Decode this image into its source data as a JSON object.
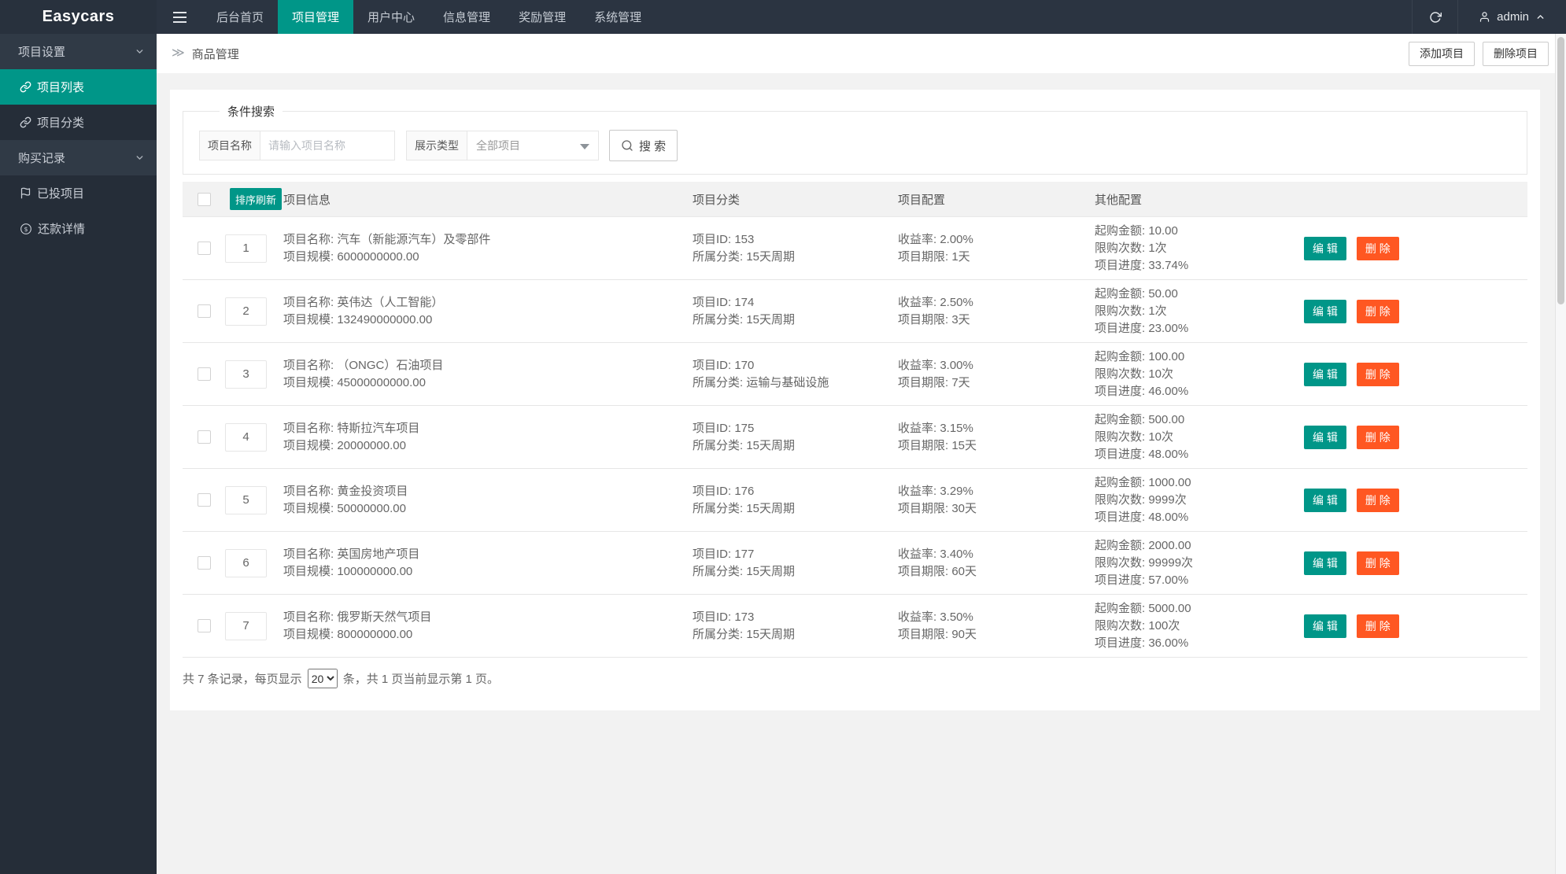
{
  "brand": "Easycars",
  "colors": {
    "accent": "#009688",
    "danger": "#ff5722",
    "navbar": "#2b3441",
    "sidebar": "#252d38"
  },
  "icons": {
    "menu": "hamburger-icon",
    "refresh": "refresh-icon",
    "user": "user-icon",
    "caret_up": "chevron-up-icon",
    "breadcrumb": "double-angle-icon",
    "link": "link-icon",
    "flag": "flag-icon",
    "dollar": "dollar-circle-icon",
    "chevron_down": "chevron-down-icon",
    "search": "search-icon",
    "select_caret": "chevron-down-icon"
  },
  "navbar": {
    "items": [
      {
        "label": "后台首页"
      },
      {
        "label": "项目管理",
        "active": true
      },
      {
        "label": "用户中心"
      },
      {
        "label": "信息管理"
      },
      {
        "label": "奖励管理"
      },
      {
        "label": "系统管理"
      }
    ],
    "user": "admin"
  },
  "sidebar": {
    "items": [
      {
        "label": "项目设置",
        "kind": "parent",
        "icon": "chevron-down"
      },
      {
        "label": "项目列表",
        "kind": "child",
        "icon": "link",
        "active": true
      },
      {
        "label": "项目分类",
        "kind": "child",
        "icon": "link"
      },
      {
        "label": "购买记录",
        "kind": "parent",
        "icon": "chevron-down"
      },
      {
        "label": "已投项目",
        "kind": "child",
        "icon": "flag"
      },
      {
        "label": "还款详情",
        "kind": "child",
        "icon": "dollar"
      }
    ]
  },
  "breadcrumb": {
    "title": "商品管理"
  },
  "toolbar": {
    "add_label": "添加项目",
    "delete_label": "删除项目"
  },
  "search": {
    "legend": "条件搜索",
    "name_label": "项目名称",
    "name_placeholder": "请输入项目名称",
    "type_label": "展示类型",
    "type_value": "全部项目",
    "button_label": "搜 索"
  },
  "table": {
    "sort_refresh_label": "排序刷新",
    "headers": {
      "info": "项目信息",
      "category": "项目分类",
      "config": "项目配置",
      "other": "其他配置"
    },
    "edit_label": "编 辑",
    "delete_label": "删 除",
    "rows": [
      {
        "sort": "1",
        "info1": "项目名称: 汽车（新能源汽车）及零部件",
        "info2": "项目规模: 6000000000.00",
        "cat1": "项目ID: 153",
        "cat2": "所属分类: 15天周期",
        "cfg1": "收益率: 2.00%",
        "cfg2": "项目期限: 1天",
        "oth1": "起购金额: 10.00",
        "oth2": "限购次数: 1次",
        "oth3": "项目进度: 33.74%"
      },
      {
        "sort": "2",
        "info1": "项目名称: 英伟达（人工智能）",
        "info2": "项目规模: 132490000000.00",
        "cat1": "项目ID: 174",
        "cat2": "所属分类: 15天周期",
        "cfg1": "收益率: 2.50%",
        "cfg2": "项目期限: 3天",
        "oth1": "起购金额: 50.00",
        "oth2": "限购次数: 1次",
        "oth3": "项目进度: 23.00%"
      },
      {
        "sort": "3",
        "info1": "项目名称: （ONGC）石油项目",
        "info2": "项目规模: 45000000000.00",
        "cat1": "项目ID: 170",
        "cat2": "所属分类: 运输与基础设施",
        "cfg1": "收益率: 3.00%",
        "cfg2": "项目期限: 7天",
        "oth1": "起购金额: 100.00",
        "oth2": "限购次数: 10次",
        "oth3": "项目进度: 46.00%"
      },
      {
        "sort": "4",
        "info1": "项目名称: 特斯拉汽车项目",
        "info2": "项目规模: 20000000.00",
        "cat1": "项目ID: 175",
        "cat2": "所属分类: 15天周期",
        "cfg1": "收益率: 3.15%",
        "cfg2": "项目期限: 15天",
        "oth1": "起购金额: 500.00",
        "oth2": "限购次数: 10次",
        "oth3": "项目进度: 48.00%"
      },
      {
        "sort": "5",
        "info1": "项目名称: 黄金投资项目",
        "info2": "项目规模: 50000000.00",
        "cat1": "项目ID: 176",
        "cat2": "所属分类: 15天周期",
        "cfg1": "收益率: 3.29%",
        "cfg2": "项目期限: 30天",
        "oth1": "起购金额: 1000.00",
        "oth2": "限购次数: 9999次",
        "oth3": "项目进度: 48.00%"
      },
      {
        "sort": "6",
        "info1": "项目名称: 英国房地产项目",
        "info2": "项目规模: 100000000.00",
        "cat1": "项目ID: 177",
        "cat2": "所属分类: 15天周期",
        "cfg1": "收益率: 3.40%",
        "cfg2": "项目期限: 60天",
        "oth1": "起购金额: 2000.00",
        "oth2": "限购次数: 99999次",
        "oth3": "项目进度: 57.00%"
      },
      {
        "sort": "7",
        "info1": "项目名称: 俄罗斯天然气项目",
        "info2": "项目规模: 800000000.00",
        "cat1": "项目ID: 173",
        "cat2": "所属分类: 15天周期",
        "cfg1": "收益率: 3.50%",
        "cfg2": "项目期限: 90天",
        "oth1": "起购金额: 5000.00",
        "oth2": "限购次数: 100次",
        "oth3": "项目进度: 36.00%"
      }
    ]
  },
  "pagination": {
    "prefix": "共 7 条记录，每页显示",
    "per_page": "20",
    "suffix": "条，共 1 页当前显示第 1 页。"
  }
}
